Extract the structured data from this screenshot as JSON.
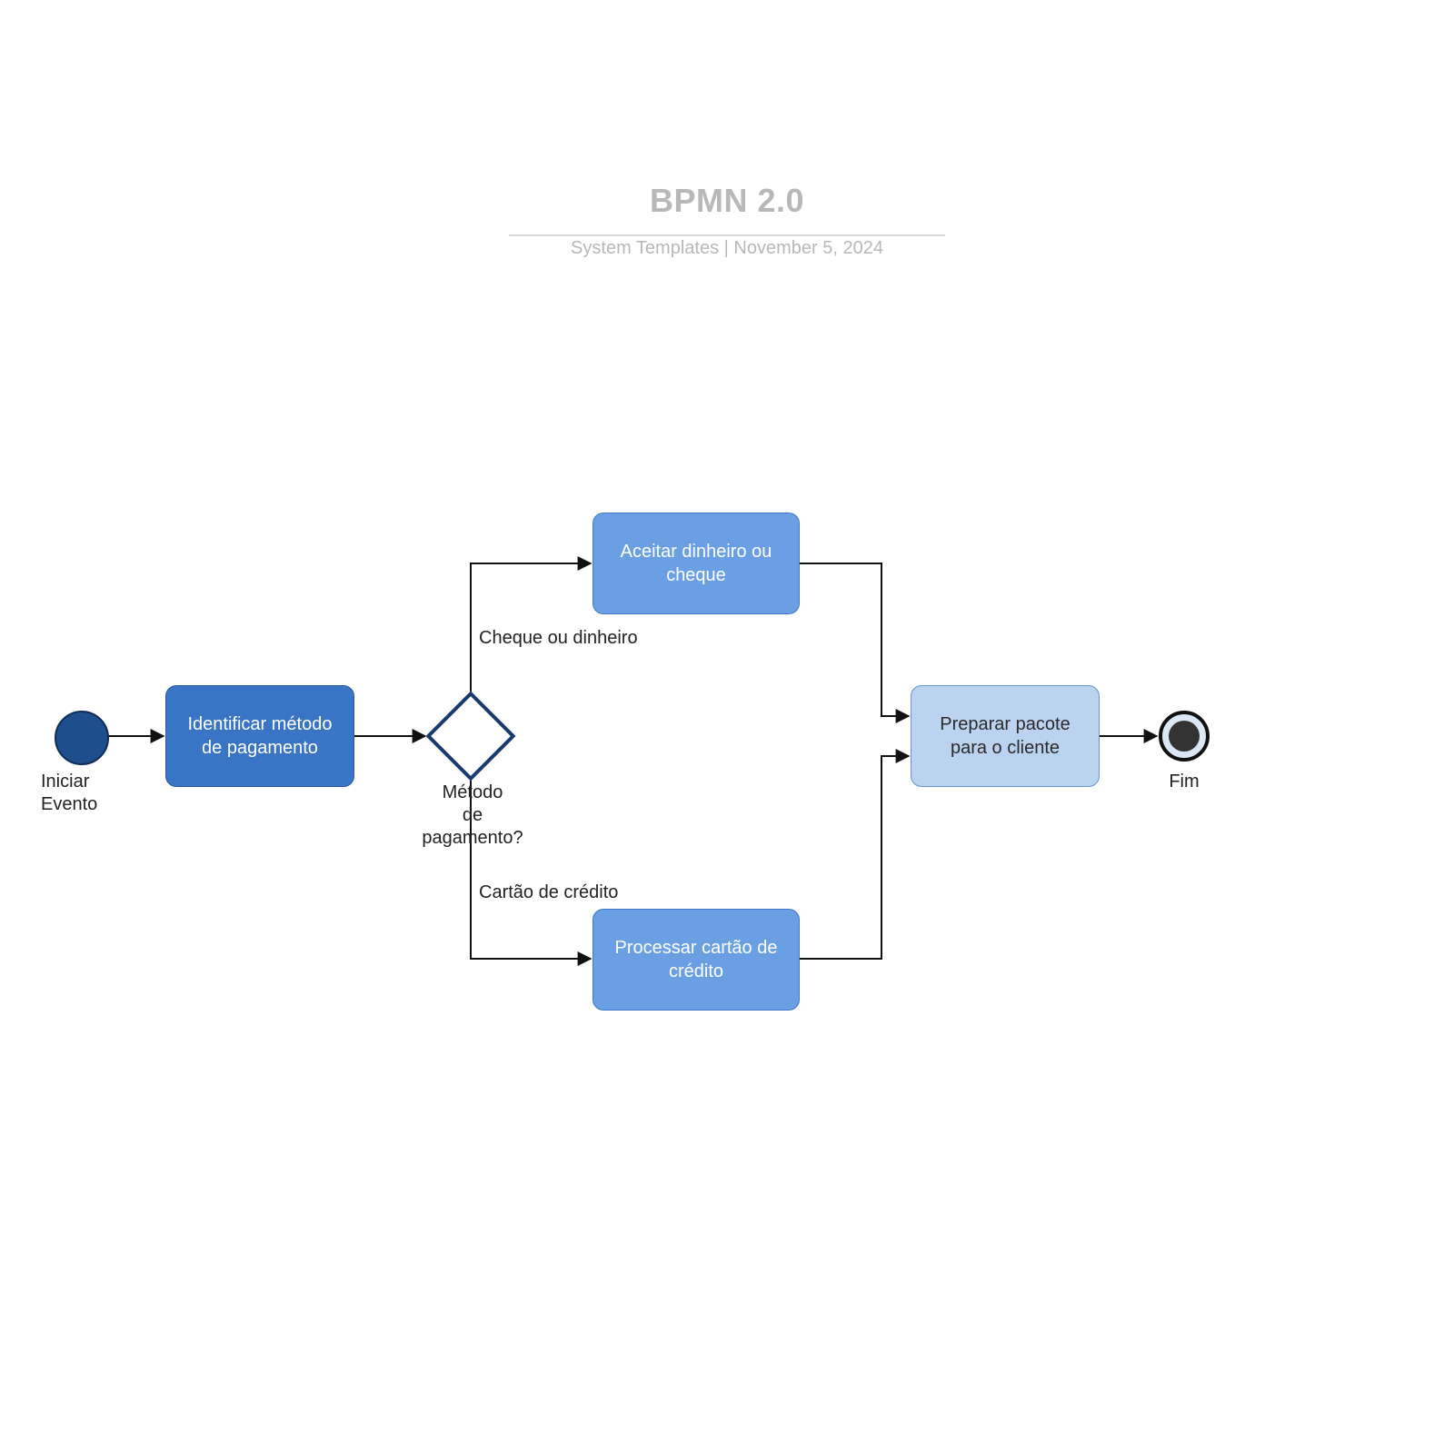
{
  "header": {
    "title": "BPMN 2.0",
    "subtitle_template": "System Templates",
    "subtitle_date": "November 5, 2024",
    "subtitle_sep": "  |  "
  },
  "nodes": {
    "start": {
      "label": "Iniciar\nEvento"
    },
    "identify": {
      "label": "Identificar método de pagamento"
    },
    "gateway": {
      "label": "Método\nde\npagamento?"
    },
    "accept": {
      "label": "Aceitar dinheiro ou cheque"
    },
    "process": {
      "label": "Processar cartão de crédito"
    },
    "prepare": {
      "label": "Preparar pacote para o cliente"
    },
    "end": {
      "label": "Fim"
    }
  },
  "edges": {
    "cash_label": "Cheque ou dinheiro",
    "card_label": "Cartão de crédito"
  }
}
